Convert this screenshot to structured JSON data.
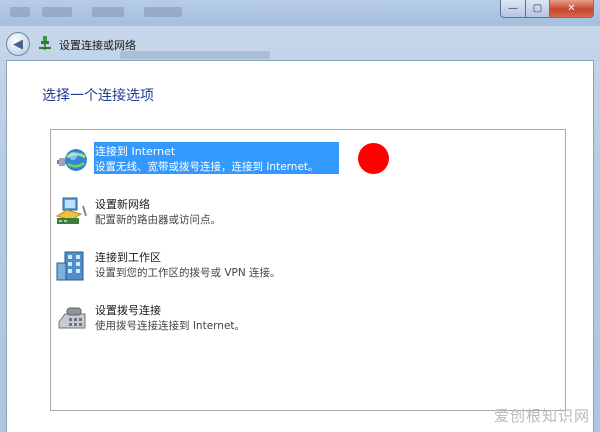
{
  "window": {
    "nav_title": "设置连接或网络",
    "min_glyph": "—",
    "max_glyph": "▢",
    "close_glyph": "✕",
    "back_glyph": "◀"
  },
  "main": {
    "heading": "选择一个连接选项",
    "options": [
      {
        "title": "连接到 Internet",
        "desc": "设置无线、宽带或拨号连接，连接到 Internet。",
        "icon": "globe-network-icon",
        "selected": true
      },
      {
        "title": "设置新网络",
        "desc": "配置新的路由器或访问点。",
        "icon": "router-network-icon",
        "selected": false
      },
      {
        "title": "连接到工作区",
        "desc": "设置到您的工作区的拨号或 VPN 连接。",
        "icon": "building-icon",
        "selected": false
      },
      {
        "title": "设置拨号连接",
        "desc": "使用拨号连接连接到 Internet。",
        "icon": "dialup-phone-icon",
        "selected": false
      }
    ]
  },
  "watermark": "爱创根知识网",
  "colors": {
    "selection": "#3399ff",
    "heading": "#1e3d8f",
    "marker": "#ff0000"
  }
}
